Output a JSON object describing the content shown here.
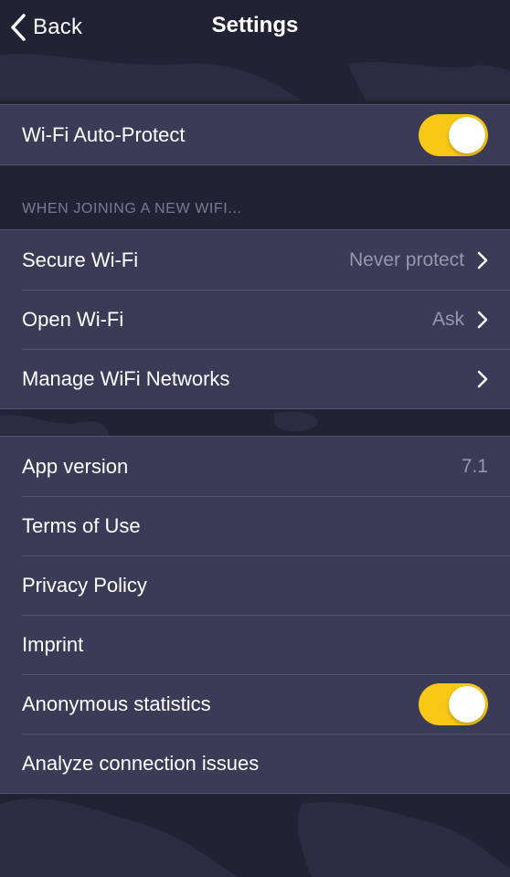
{
  "nav": {
    "back_label": "Back",
    "title": "Settings"
  },
  "group1": {
    "wifi_auto_protect": {
      "label": "Wi-Fi Auto-Protect",
      "toggle_on": true
    }
  },
  "section_header": "WHEN JOINING A NEW WIFI...",
  "group2": {
    "secure_wifi": {
      "label": "Secure Wi-Fi",
      "value": "Never protect"
    },
    "open_wifi": {
      "label": "Open Wi-Fi",
      "value": "Ask"
    },
    "manage_networks": {
      "label": "Manage WiFi Networks"
    }
  },
  "group3": {
    "app_version": {
      "label": "App version",
      "value": "7.1"
    },
    "terms": {
      "label": "Terms of Use"
    },
    "privacy": {
      "label": "Privacy Policy"
    },
    "imprint": {
      "label": "Imprint"
    },
    "anonymous_stats": {
      "label": "Anonymous statistics",
      "toggle_on": true
    },
    "analyze": {
      "label": "Analyze connection issues"
    }
  },
  "colors": {
    "background": "#232235",
    "cell": "#3c3b57",
    "toggle_on": "#f9c816",
    "secondary_text": "#9796ad"
  }
}
